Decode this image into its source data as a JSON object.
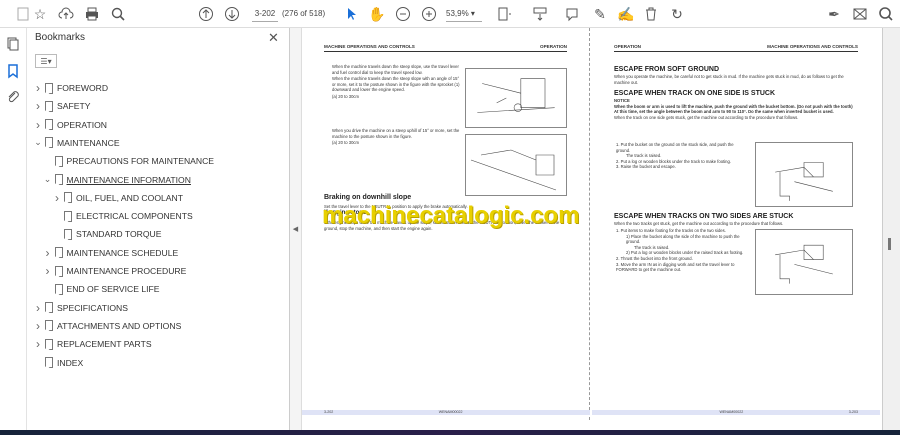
{
  "toolbar": {
    "page_input": "3-202",
    "page_count": "(276 of 518)",
    "zoom": "53,9%"
  },
  "bookmarks": {
    "title": "Bookmarks",
    "items": [
      {
        "label": "FOREWORD",
        "level": 0,
        "chev": "right"
      },
      {
        "label": "SAFETY",
        "level": 0,
        "chev": "right"
      },
      {
        "label": "OPERATION",
        "level": 0,
        "chev": "right"
      },
      {
        "label": "MAINTENANCE",
        "level": 0,
        "chev": "down"
      },
      {
        "label": "PRECAUTIONS FOR MAINTENANCE",
        "level": 1,
        "chev": ""
      },
      {
        "label": "MAINTENANCE INFORMATION",
        "level": 1,
        "chev": "down"
      },
      {
        "label": "OIL, FUEL, AND COOLANT",
        "level": 2,
        "chev": "right"
      },
      {
        "label": "ELECTRICAL COMPONENTS",
        "level": 2,
        "chev": ""
      },
      {
        "label": "STANDARD TORQUE",
        "level": 2,
        "chev": ""
      },
      {
        "label": "MAINTENANCE SCHEDULE",
        "level": 1,
        "chev": "right"
      },
      {
        "label": "MAINTENANCE PROCEDURE",
        "level": 1,
        "chev": "right"
      },
      {
        "label": "END OF SERVICE LIFE",
        "level": 1,
        "chev": ""
      },
      {
        "label": "SPECIFICATIONS",
        "level": 0,
        "chev": "right"
      },
      {
        "label": "ATTACHMENTS AND OPTIONS",
        "level": 0,
        "chev": "right"
      },
      {
        "label": "REPLACEMENT PARTS",
        "level": 0,
        "chev": "right"
      },
      {
        "label": "INDEX",
        "level": 0,
        "chev": ""
      }
    ]
  },
  "page_left": {
    "header_left": "MACHINE OPERATIONS AND CONTROLS",
    "header_right": "OPERATION",
    "b1": "When the machine travels down the steep slope, use the travel lever and fuel control dial to keep the travel speed low.",
    "b1b": "When the machine travels down the steep slope with an angle of 15° or more, set it to the posture shown in the figure with the sprocket (1) downward and lower the engine speed.",
    "b1c": "(a) 20 to 30cm",
    "b2": "When you drive the machine on a steep uphill of 15° or more, set the machine to the posture shown in the figure.",
    "b2c": "(a) 20 to 30cm",
    "h_brake": "Braking on downhill slope",
    "brake_text": "Set the travel lever to the NEUTRAL position to apply the brake automatically.",
    "h_engine": "If engine stops",
    "engine_text": "If the engine stops while the machine travels up the slope, set the travel lever to the NEUTRAL position, lower the bucket to the ground, stop the machine, and then start the engine again.",
    "footer_left": "3-202",
    "footer_center": "WENAM00022"
  },
  "page_right": {
    "header_left": "OPERATION",
    "header_right": "MACHINE OPERATIONS AND CONTROLS",
    "h1": "ESCAPE FROM SOFT GROUND",
    "p1": "When you operate the machine, be careful not to get stuck in mud. If the machine gets stuck in mud, do as follows to get the machine out.",
    "h2": "ESCAPE WHEN TRACK ON ONE SIDE IS STUCK",
    "notice": "NOTICE",
    "notice_text": "When the boom or arm is used to lift the machine, push the ground with the bucket bottom. (Do not push with the tooth) At this time, set the angle between the boom and arm to 90 to 110°. Do the same when inverted bucket is used.",
    "p2": "When the track on one side gets stuck, get the machine out according to the procedure that follows.",
    "s1": "1.  Put the bucket on the ground on the stuck side, and push the ground.",
    "s1b": "The track is raised.",
    "s2": "2.  Put a log or wooden blocks under the track to make footing.",
    "s3": "3.  Raise the bucket and escape.",
    "h3": "ESCAPE WHEN TRACKS ON TWO SIDES ARE STUCK",
    "p3": "When the two tracks get stuck, get the machine out according to the procedure that follows.",
    "t1": "1.  Put items to make footing for the tracks on the two sides.",
    "t1a": "1)  Place the bucket along the side of the machine to push the ground.",
    "t1b": "The track is raised.",
    "t1c": "2)  Put a log or wooden blocks under the raised track as footing.",
    "t2": "2.  Thrust the bucket into the front ground.",
    "t3": "3.  Move the arm IN as in digging work and set the travel lever to FORWARD to get the machine out.",
    "footer_center": "WENAM00022",
    "footer_right": "3-203"
  },
  "watermark": "machinecatalogic.com"
}
